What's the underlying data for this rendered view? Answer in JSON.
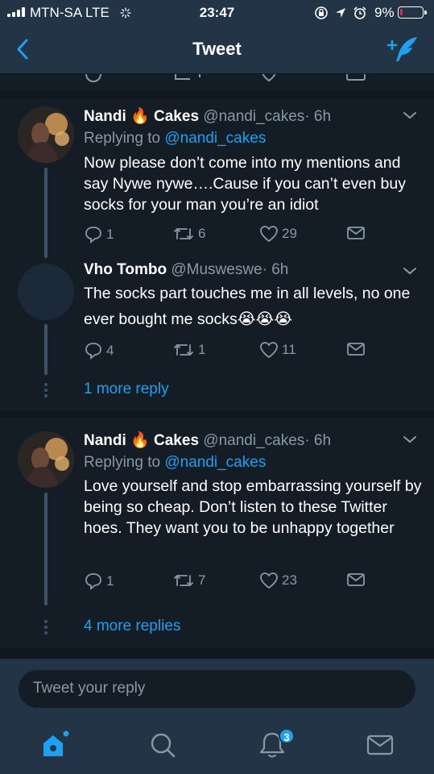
{
  "status_bar": {
    "carrier": "MTN-SA  LTE",
    "time": "23:47",
    "battery_percent": "9%",
    "battery_level": 0.09,
    "icons": [
      "signal-bars-icon",
      "activity-icon",
      "orientation-lock-icon",
      "location-arrow-icon",
      "alarm-icon",
      "battery-icon"
    ]
  },
  "nav": {
    "title": "Tweet",
    "back_icon": "chevron-left-icon",
    "compose_icon": "compose-tweet-icon"
  },
  "tweets": [
    {
      "name": "Nandi",
      "name_suffix": "Cakes",
      "emoji": "🔥",
      "handle": "@nandi_cakes",
      "time": "· 6h",
      "replying_prefix": "Replying to",
      "replying_handle": "@nandi_cakes",
      "text": "Now please don’t come into my mentions and say Nywe nywe….Cause if you can’t even buy socks for your man you’re an idiot",
      "replies": "1",
      "retweets": "6",
      "likes": "29"
    },
    {
      "name": "Vho Tombo",
      "handle": "@Musweswe",
      "time": "· 6h",
      "text": "The socks part touches me in all levels,  no one ever bought me socks😭😭😭",
      "replies": "4",
      "retweets": "1",
      "likes": "11"
    },
    {
      "name": "Nandi",
      "name_suffix": "Cakes",
      "emoji": "🔥",
      "handle": "@nandi_cakes",
      "time": "· 6h",
      "replying_prefix": "Replying to",
      "replying_handle": "@nandi_cakes",
      "text": "Love yourself and stop embarrassing yourself by being so cheap. Don’t listen to these Twitter hoes. They want you to be unhappy together",
      "replies": "1",
      "retweets": "7",
      "likes": "23"
    }
  ],
  "more_links": {
    "first": "1 more reply",
    "second": "4 more replies"
  },
  "composer": {
    "placeholder": "Tweet your reply"
  },
  "tab_bar": {
    "items": [
      "home-icon",
      "search-icon",
      "notifications-icon",
      "messages-icon"
    ],
    "notification_count": "3"
  },
  "colors": {
    "background": "#141d26",
    "bar": "#243447",
    "accent": "#1da1f2",
    "secondary_text": "#8899a6"
  }
}
